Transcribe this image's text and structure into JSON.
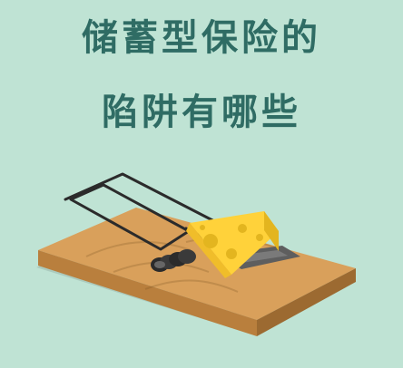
{
  "title": {
    "line1": "储蓄型保险的",
    "line2": "陷阱有哪些"
  },
  "illustration": {
    "subject": "mousetrap-with-cheese"
  },
  "colors": {
    "background": "#bfe3d4",
    "title": "#2f6c64",
    "board_top": "#d9a05b",
    "board_side": "#b97f3d",
    "cheese": "#ffd23a",
    "cheese_shadow": "#e3b51f",
    "metal": "#2b2b2b"
  }
}
